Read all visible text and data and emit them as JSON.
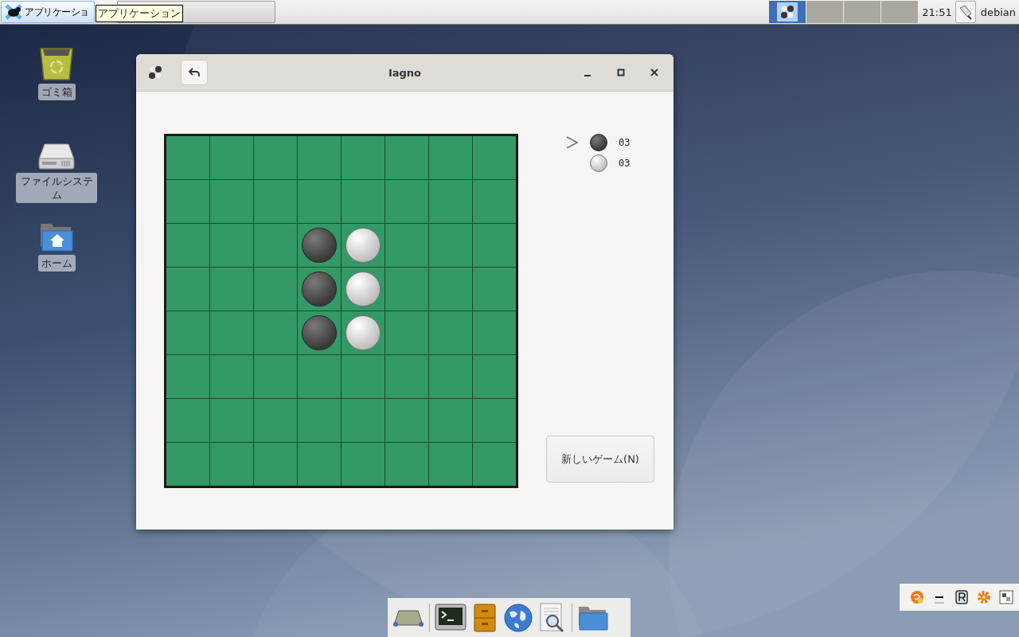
{
  "top_panel": {
    "app_menu": "アプリケーショ",
    "tooltip": "アプリケーション",
    "workspaces": [
      {
        "selected": true
      },
      {
        "selected": false
      },
      {
        "selected": false
      },
      {
        "selected": false
      }
    ],
    "clock": "21:51",
    "user": "debian"
  },
  "desktop_icons": [
    {
      "kind": "trash",
      "label": "ゴミ箱"
    },
    {
      "kind": "drive",
      "label": "ファイルシステム"
    },
    {
      "kind": "home",
      "label": "ホーム"
    }
  ],
  "window": {
    "title": "Iagno",
    "board": [
      [
        {
          "kind": "empty"
        },
        {
          "kind": "empty"
        },
        {
          "kind": "empty"
        },
        {
          "kind": "empty"
        },
        {
          "kind": "empty"
        },
        {
          "kind": "empty"
        },
        {
          "kind": "empty"
        },
        {
          "kind": "empty"
        }
      ],
      [
        {
          "kind": "empty"
        },
        {
          "kind": "empty"
        },
        {
          "kind": "empty"
        },
        {
          "kind": "empty"
        },
        {
          "kind": "empty"
        },
        {
          "kind": "empty"
        },
        {
          "kind": "empty"
        },
        {
          "kind": "empty"
        }
      ],
      [
        {
          "kind": "empty"
        },
        {
          "kind": "empty"
        },
        {
          "kind": "empty"
        },
        {
          "kind": "dark"
        },
        {
          "kind": "light"
        },
        {
          "kind": "empty"
        },
        {
          "kind": "empty"
        },
        {
          "kind": "empty"
        }
      ],
      [
        {
          "kind": "empty"
        },
        {
          "kind": "empty"
        },
        {
          "kind": "empty"
        },
        {
          "kind": "dark"
        },
        {
          "kind": "light"
        },
        {
          "kind": "empty"
        },
        {
          "kind": "empty"
        },
        {
          "kind": "empty"
        }
      ],
      [
        {
          "kind": "empty"
        },
        {
          "kind": "empty"
        },
        {
          "kind": "empty"
        },
        {
          "kind": "dark"
        },
        {
          "kind": "light"
        },
        {
          "kind": "empty"
        },
        {
          "kind": "empty"
        },
        {
          "kind": "empty"
        }
      ],
      [
        {
          "kind": "empty"
        },
        {
          "kind": "empty"
        },
        {
          "kind": "empty"
        },
        {
          "kind": "empty"
        },
        {
          "kind": "empty"
        },
        {
          "kind": "empty"
        },
        {
          "kind": "empty"
        },
        {
          "kind": "empty"
        }
      ],
      [
        {
          "kind": "empty"
        },
        {
          "kind": "empty"
        },
        {
          "kind": "empty"
        },
        {
          "kind": "empty"
        },
        {
          "kind": "empty"
        },
        {
          "kind": "empty"
        },
        {
          "kind": "empty"
        },
        {
          "kind": "empty"
        }
      ],
      [
        {
          "kind": "empty"
        },
        {
          "kind": "empty"
        },
        {
          "kind": "empty"
        },
        {
          "kind": "empty"
        },
        {
          "kind": "empty"
        },
        {
          "kind": "empty"
        },
        {
          "kind": "empty"
        },
        {
          "kind": "empty"
        }
      ]
    ],
    "scores": [
      {
        "kind": "dark",
        "score": "03",
        "selected": true
      },
      {
        "kind": "light",
        "score": "03",
        "selected": false
      }
    ],
    "new_game_button": "新しいゲーム(N)"
  }
}
